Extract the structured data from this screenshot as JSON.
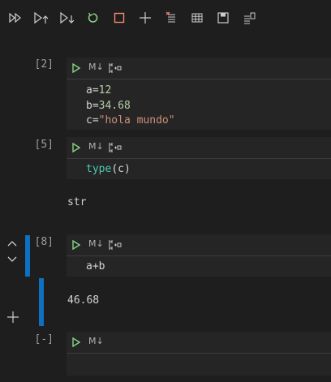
{
  "toolbar": {
    "buttons": [
      {
        "name": "run-all",
        "icon": "run-all-icon"
      },
      {
        "name": "run-above",
        "icon": "run-above-icon"
      },
      {
        "name": "run-below",
        "icon": "run-below-icon"
      },
      {
        "name": "restart-kernel",
        "icon": "restart-icon"
      },
      {
        "name": "interrupt-kernel",
        "icon": "stop-icon"
      },
      {
        "name": "add-cell",
        "icon": "plus-icon"
      },
      {
        "name": "clear-outputs",
        "icon": "clear-outputs-icon"
      },
      {
        "name": "variables",
        "icon": "table-icon"
      },
      {
        "name": "save",
        "icon": "save-icon"
      },
      {
        "name": "export",
        "icon": "export-icon"
      }
    ]
  },
  "colors": {
    "background": "#1e1e1e",
    "cell_bg": "#252526",
    "run_green": "#89d185",
    "restart_green": "#89d185",
    "stop_red": "#f48771",
    "active_bar": "#0e70c0",
    "number": "#b5cea8",
    "string": "#ce9178",
    "function": "#4ec9b0"
  },
  "cells": [
    {
      "exec_count": "[2]",
      "md_label": "M↓",
      "lines": [
        {
          "var": "a",
          "op": "=",
          "value": "12"
        },
        {
          "var": "b",
          "op": "=",
          "value": "34.68"
        },
        {
          "var": "c",
          "op": "=",
          "value": "\"hola mundo\""
        }
      ]
    },
    {
      "exec_count": "[5]",
      "md_label": "M↓",
      "code": {
        "fn": "type",
        "args": "(c)"
      },
      "output": "str"
    },
    {
      "exec_count": "[8]",
      "md_label": "M↓",
      "code": "a+b",
      "output": "46.68"
    },
    {
      "exec_count": "[-]",
      "md_label": "M↓",
      "code": ""
    }
  ]
}
